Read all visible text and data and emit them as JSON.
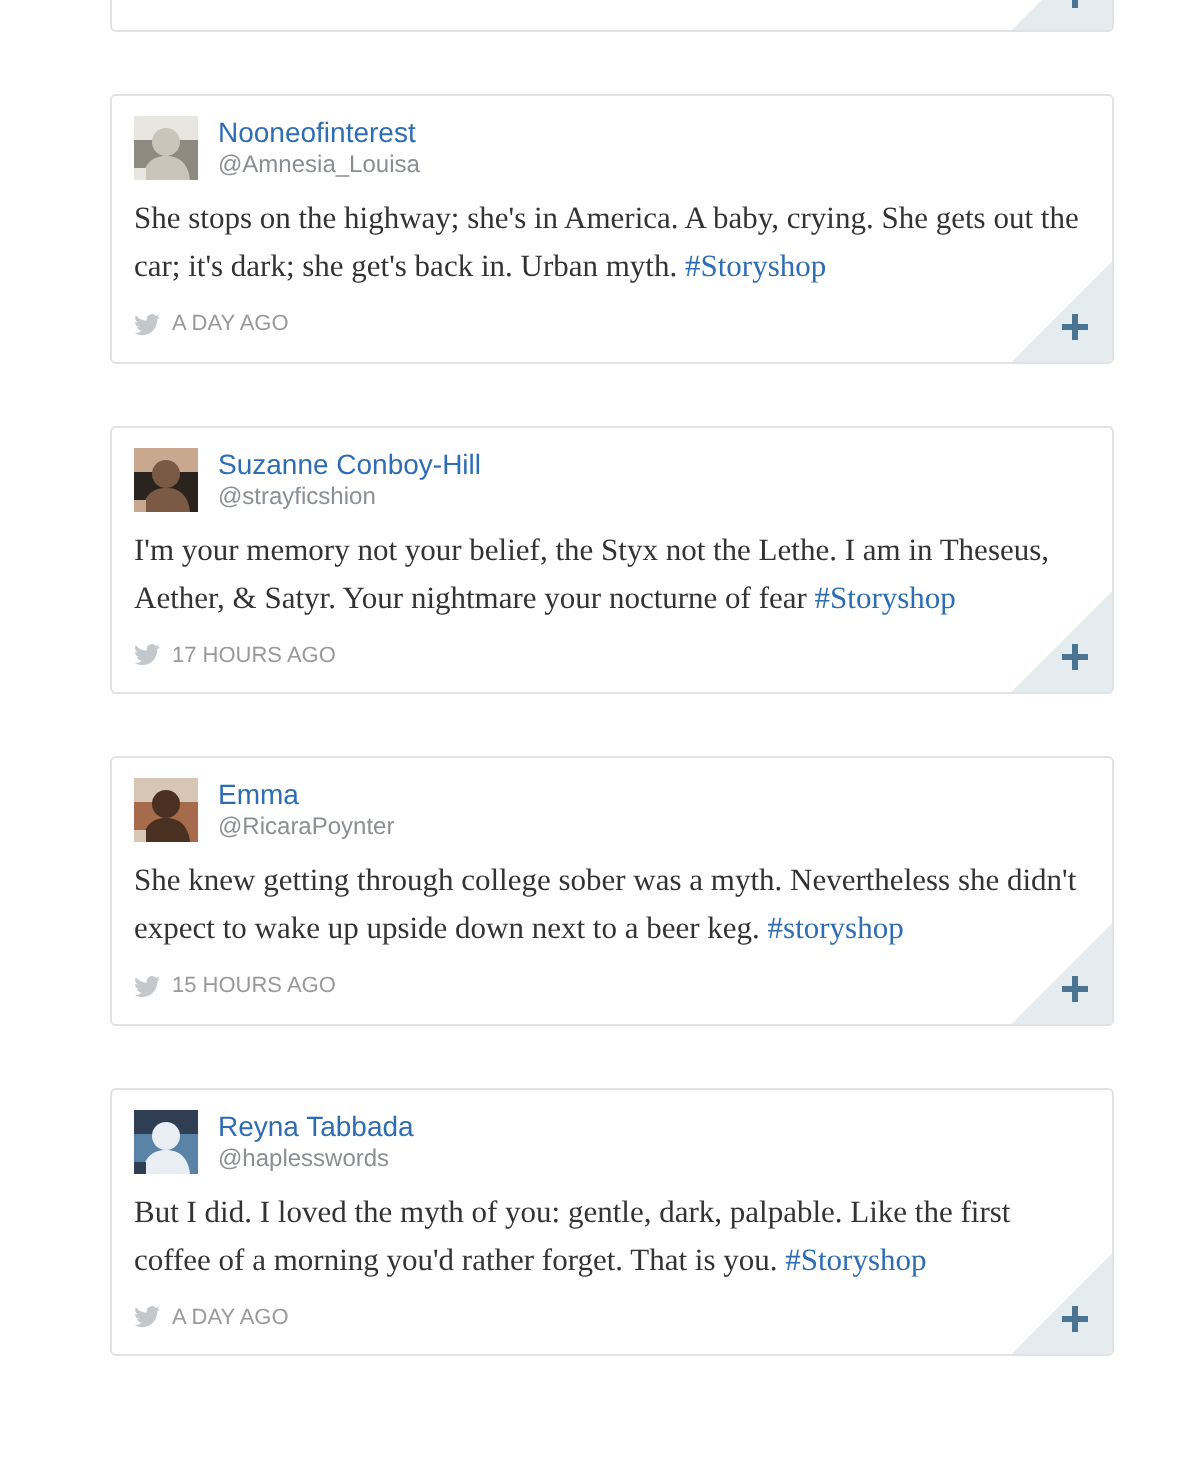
{
  "tweets": [
    {
      "name": "Nooneofinterest",
      "handle": "@Amnesia_Louisa",
      "text": "She stops on the highway; she's in America. A baby, crying. She gets out the car; it's dark; she get's back in. Urban myth.",
      "hashtag": "#Storyshop",
      "time": "A DAY AGO"
    },
    {
      "name": "Suzanne Conboy-Hill",
      "handle": "@strayficshion",
      "text": "I'm your memory not your belief, the Styx not the Lethe. I am in Theseus, Aether, & Satyr. Your nightmare your nocturne of fear",
      "hashtag": "#Storyshop",
      "time": "17 HOURS AGO"
    },
    {
      "name": "Emma",
      "handle": "@RicaraPoynter",
      "text": "She knew getting through college sober was a myth. Nevertheless she didn't expect to wake up upside down next to a beer keg.",
      "hashtag": "#storyshop",
      "time": "15 HOURS AGO"
    },
    {
      "name": "Reyna Tabbada",
      "handle": "@haplesswords",
      "text": "But I did. I loved the myth of you: gentle, dark, palpable. Like the first coffee of a morning you'd rather forget. That is you.",
      "hashtag": "#Storyshop",
      "time": "A DAY AGO"
    }
  ]
}
